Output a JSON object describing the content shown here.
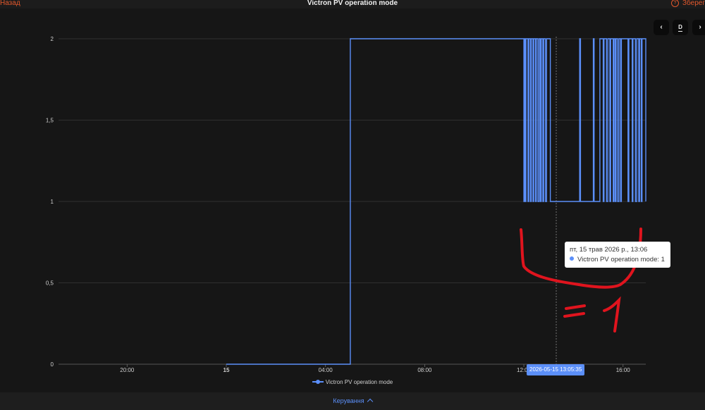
{
  "header": {
    "back_label": "Назад",
    "title": "Victron PV operation mode",
    "save_label": "Зберег"
  },
  "controls": {
    "prev_label": "‹",
    "period_label": "D",
    "next_label": "›"
  },
  "tooltip": {
    "date_line": "пт, 15 трав 2026 р., 13:06",
    "series_line": "Victron PV operation mode: 1"
  },
  "axis_pointer": {
    "label": "2026-05-15 13:05:35"
  },
  "footer": {
    "controls_label": "Керування"
  },
  "colors": {
    "series": "#5b8ff9",
    "annotation": "#e0141e",
    "accent": "#e2582c"
  },
  "chart_data": {
    "type": "line",
    "step": true,
    "title": "Victron PV operation mode",
    "xlabel": "",
    "ylabel": "",
    "x_range": [
      "2026-05-14 17:14",
      "2026-05-15 16:55"
    ],
    "ylim": [
      0,
      2
    ],
    "y_ticks": [
      "0",
      "0,5",
      "1",
      "1,5",
      "2"
    ],
    "y_tick_values": [
      0,
      0.5,
      1,
      1.5,
      2
    ],
    "x_ticks": [
      {
        "label": "20:00",
        "t": "2026-05-14 20:00",
        "bold": false
      },
      {
        "label": "15",
        "t": "2026-05-15 00:00",
        "bold": true
      },
      {
        "label": "04:00",
        "t": "2026-05-15 04:00",
        "bold": false
      },
      {
        "label": "08:00",
        "t": "2026-05-15 08:00",
        "bold": false
      },
      {
        "label": "12:00",
        "t": "2026-05-15 12:00",
        "bold": false
      },
      {
        "label": "16:00",
        "t": "2026-05-15 16:00",
        "bold": false
      }
    ],
    "grid": true,
    "legend_position": "bottom",
    "series": [
      {
        "name": "Victron PV operation mode",
        "points": [
          [
            "2026-05-15 00:00",
            0
          ],
          [
            "2026-05-15 05:00",
            2
          ],
          [
            "2026-05-15 12:00",
            1
          ],
          [
            "2026-05-15 12:02",
            2
          ],
          [
            "2026-05-15 12:04",
            1
          ],
          [
            "2026-05-15 12:05",
            2
          ],
          [
            "2026-05-15 12:10",
            1
          ],
          [
            "2026-05-15 12:12",
            2
          ],
          [
            "2026-05-15 12:16",
            1
          ],
          [
            "2026-05-15 12:18",
            2
          ],
          [
            "2026-05-15 12:22",
            1
          ],
          [
            "2026-05-15 12:24",
            2
          ],
          [
            "2026-05-15 12:28",
            1
          ],
          [
            "2026-05-15 12:30",
            2
          ],
          [
            "2026-05-15 12:34",
            1
          ],
          [
            "2026-05-15 12:37",
            2
          ],
          [
            "2026-05-15 12:40",
            1
          ],
          [
            "2026-05-15 12:42",
            2
          ],
          [
            "2026-05-15 12:46",
            1
          ],
          [
            "2026-05-15 12:48",
            2
          ],
          [
            "2026-05-15 12:52",
            1
          ],
          [
            "2026-05-15 12:55",
            2
          ],
          [
            "2026-05-15 13:04",
            1
          ],
          [
            "2026-05-15 14:15",
            2
          ],
          [
            "2026-05-15 14:17",
            1
          ],
          [
            "2026-05-15 14:48",
            2
          ],
          [
            "2026-05-15 14:50",
            1
          ],
          [
            "2026-05-15 15:04",
            2
          ],
          [
            "2026-05-15 15:12",
            1
          ],
          [
            "2026-05-15 15:14",
            2
          ],
          [
            "2026-05-15 15:20",
            1
          ],
          [
            "2026-05-15 15:23",
            2
          ],
          [
            "2026-05-15 15:28",
            1
          ],
          [
            "2026-05-15 15:30",
            2
          ],
          [
            "2026-05-15 15:36",
            1
          ],
          [
            "2026-05-15 15:38",
            2
          ],
          [
            "2026-05-15 15:41",
            1
          ],
          [
            "2026-05-15 15:43",
            2
          ],
          [
            "2026-05-15 15:47",
            1
          ],
          [
            "2026-05-15 15:50",
            2
          ],
          [
            "2026-05-15 15:54",
            1
          ],
          [
            "2026-05-15 15:56",
            2
          ],
          [
            "2026-05-15 16:12",
            1
          ],
          [
            "2026-05-15 16:14",
            2
          ],
          [
            "2026-05-15 16:22",
            1
          ],
          [
            "2026-05-15 16:24",
            2
          ],
          [
            "2026-05-15 16:30",
            1
          ],
          [
            "2026-05-15 16:33",
            2
          ],
          [
            "2026-05-15 16:38",
            1
          ],
          [
            "2026-05-15 16:40",
            2
          ],
          [
            "2026-05-15 16:44",
            1
          ],
          [
            "2026-05-15 16:46",
            2
          ],
          [
            "2026-05-15 16:55",
            1
          ]
        ]
      }
    ],
    "annotations": [
      "=1"
    ]
  }
}
